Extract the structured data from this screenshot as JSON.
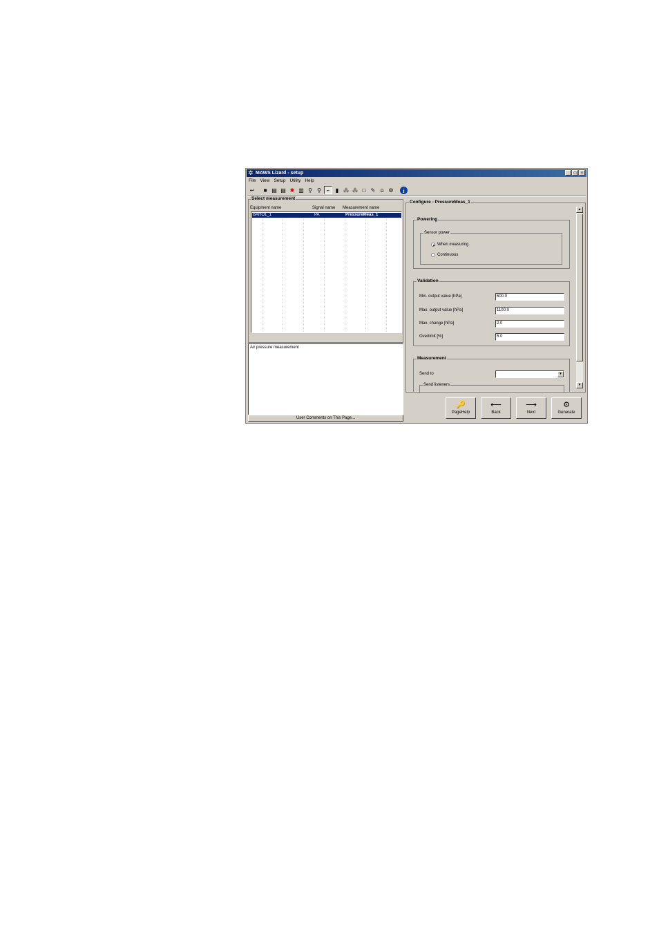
{
  "window": {
    "title": "MAWS Lizard - setup",
    "controls": {
      "minimize": "_",
      "maximize": "□",
      "close": "×"
    }
  },
  "menu": [
    "File",
    "View",
    "Setup",
    "Utility",
    "Help"
  ],
  "toolbar_icons": [
    "undo-icon",
    "stop-icon",
    "dev1-icon",
    "dev2-icon",
    "sensor-icon",
    "plot-icon",
    "walker-icon",
    "walker2-icon",
    "chart-icon",
    "tower-icon",
    "network-icon",
    "network2-icon",
    "page-icon",
    "pen-icon",
    "bell-icon",
    "gear-icon",
    "info-icon"
  ],
  "select_measurement": {
    "title": "Select measurement",
    "columns": [
      "Equipment name",
      "Signal name",
      "Measurement name"
    ],
    "rows": [
      {
        "equipment": "BARO1_1",
        "signal": "PA",
        "measurement": "PressureMeas_1",
        "selected": true
      }
    ]
  },
  "comment": {
    "text": "Air pressure measurement",
    "button": "User Comments on This Page..."
  },
  "configure": {
    "title": "Configure - PressureMeas_1",
    "powering": {
      "title": "Powering",
      "sensor_power": {
        "title": "Sensor power",
        "options": [
          "When measuring",
          "Continuous"
        ],
        "selected": "When measuring"
      }
    },
    "validation": {
      "title": "Validation",
      "fields": [
        {
          "label": "Min. output value [hPa]",
          "value": "600.0"
        },
        {
          "label": "Max. output value [hPa]",
          "value": "1100.0"
        },
        {
          "label": "Max. change [hPa]",
          "value": "2.0"
        },
        {
          "label": "Overlimit [%]",
          "value": "5.0"
        }
      ]
    },
    "measurement": {
      "title": "Measurement",
      "send_to_label": "Send to",
      "send_to_value": "",
      "send_listeners": "Send listeners"
    }
  },
  "buttons": {
    "pagehelp": "PageHelp",
    "back": "Back",
    "next": "Next",
    "generate": "Generate"
  }
}
